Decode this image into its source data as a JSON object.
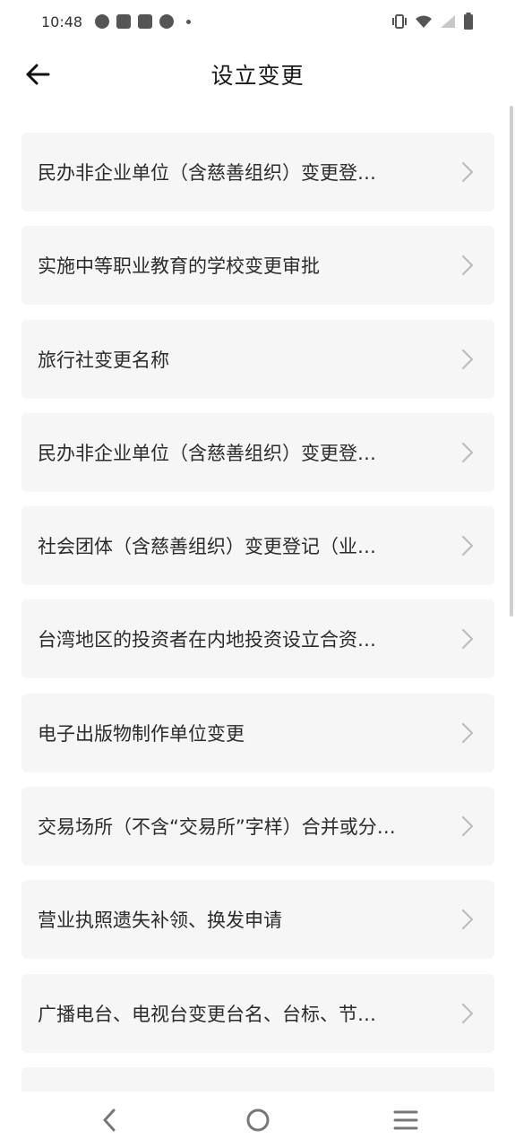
{
  "status_bar": {
    "time": "10:48",
    "icons": [
      "speedometer-icon",
      "mail-icon",
      "mail-icon",
      "shield-icon",
      "dot-icon"
    ],
    "right_icons": [
      "vibrate-icon",
      "wifi-icon",
      "signal-icon",
      "battery-icon"
    ]
  },
  "app_bar": {
    "title": "设立变更",
    "back_icon": "arrow-left-icon"
  },
  "list": {
    "items": [
      {
        "label": "民办非企业单位（含慈善组织）变更登…"
      },
      {
        "label": "实施中等职业教育的学校变更审批"
      },
      {
        "label": "旅行社变更名称"
      },
      {
        "label": "民办非企业单位（含慈善组织）变更登…"
      },
      {
        "label": "社会团体（含慈善组织）变更登记（业…"
      },
      {
        "label": "台湾地区的投资者在内地投资设立合资…"
      },
      {
        "label": "电子出版物制作单位变更"
      },
      {
        "label": "交易场所（不含“交易所”字样）合并或分…"
      },
      {
        "label": "营业执照遗失补领、换发申请"
      },
      {
        "label": "广播电台、电视台变更台名、台标、节…"
      },
      {
        "label": ""
      }
    ],
    "chevron_icon": "chevron-right-icon"
  },
  "nav_bar": {
    "icons": [
      "nav-back-icon",
      "nav-home-icon",
      "nav-menu-icon"
    ]
  },
  "colors": {
    "item_background": "#f6f6f6",
    "text": "#2b2b2b",
    "chevron": "#bdbdbd"
  }
}
